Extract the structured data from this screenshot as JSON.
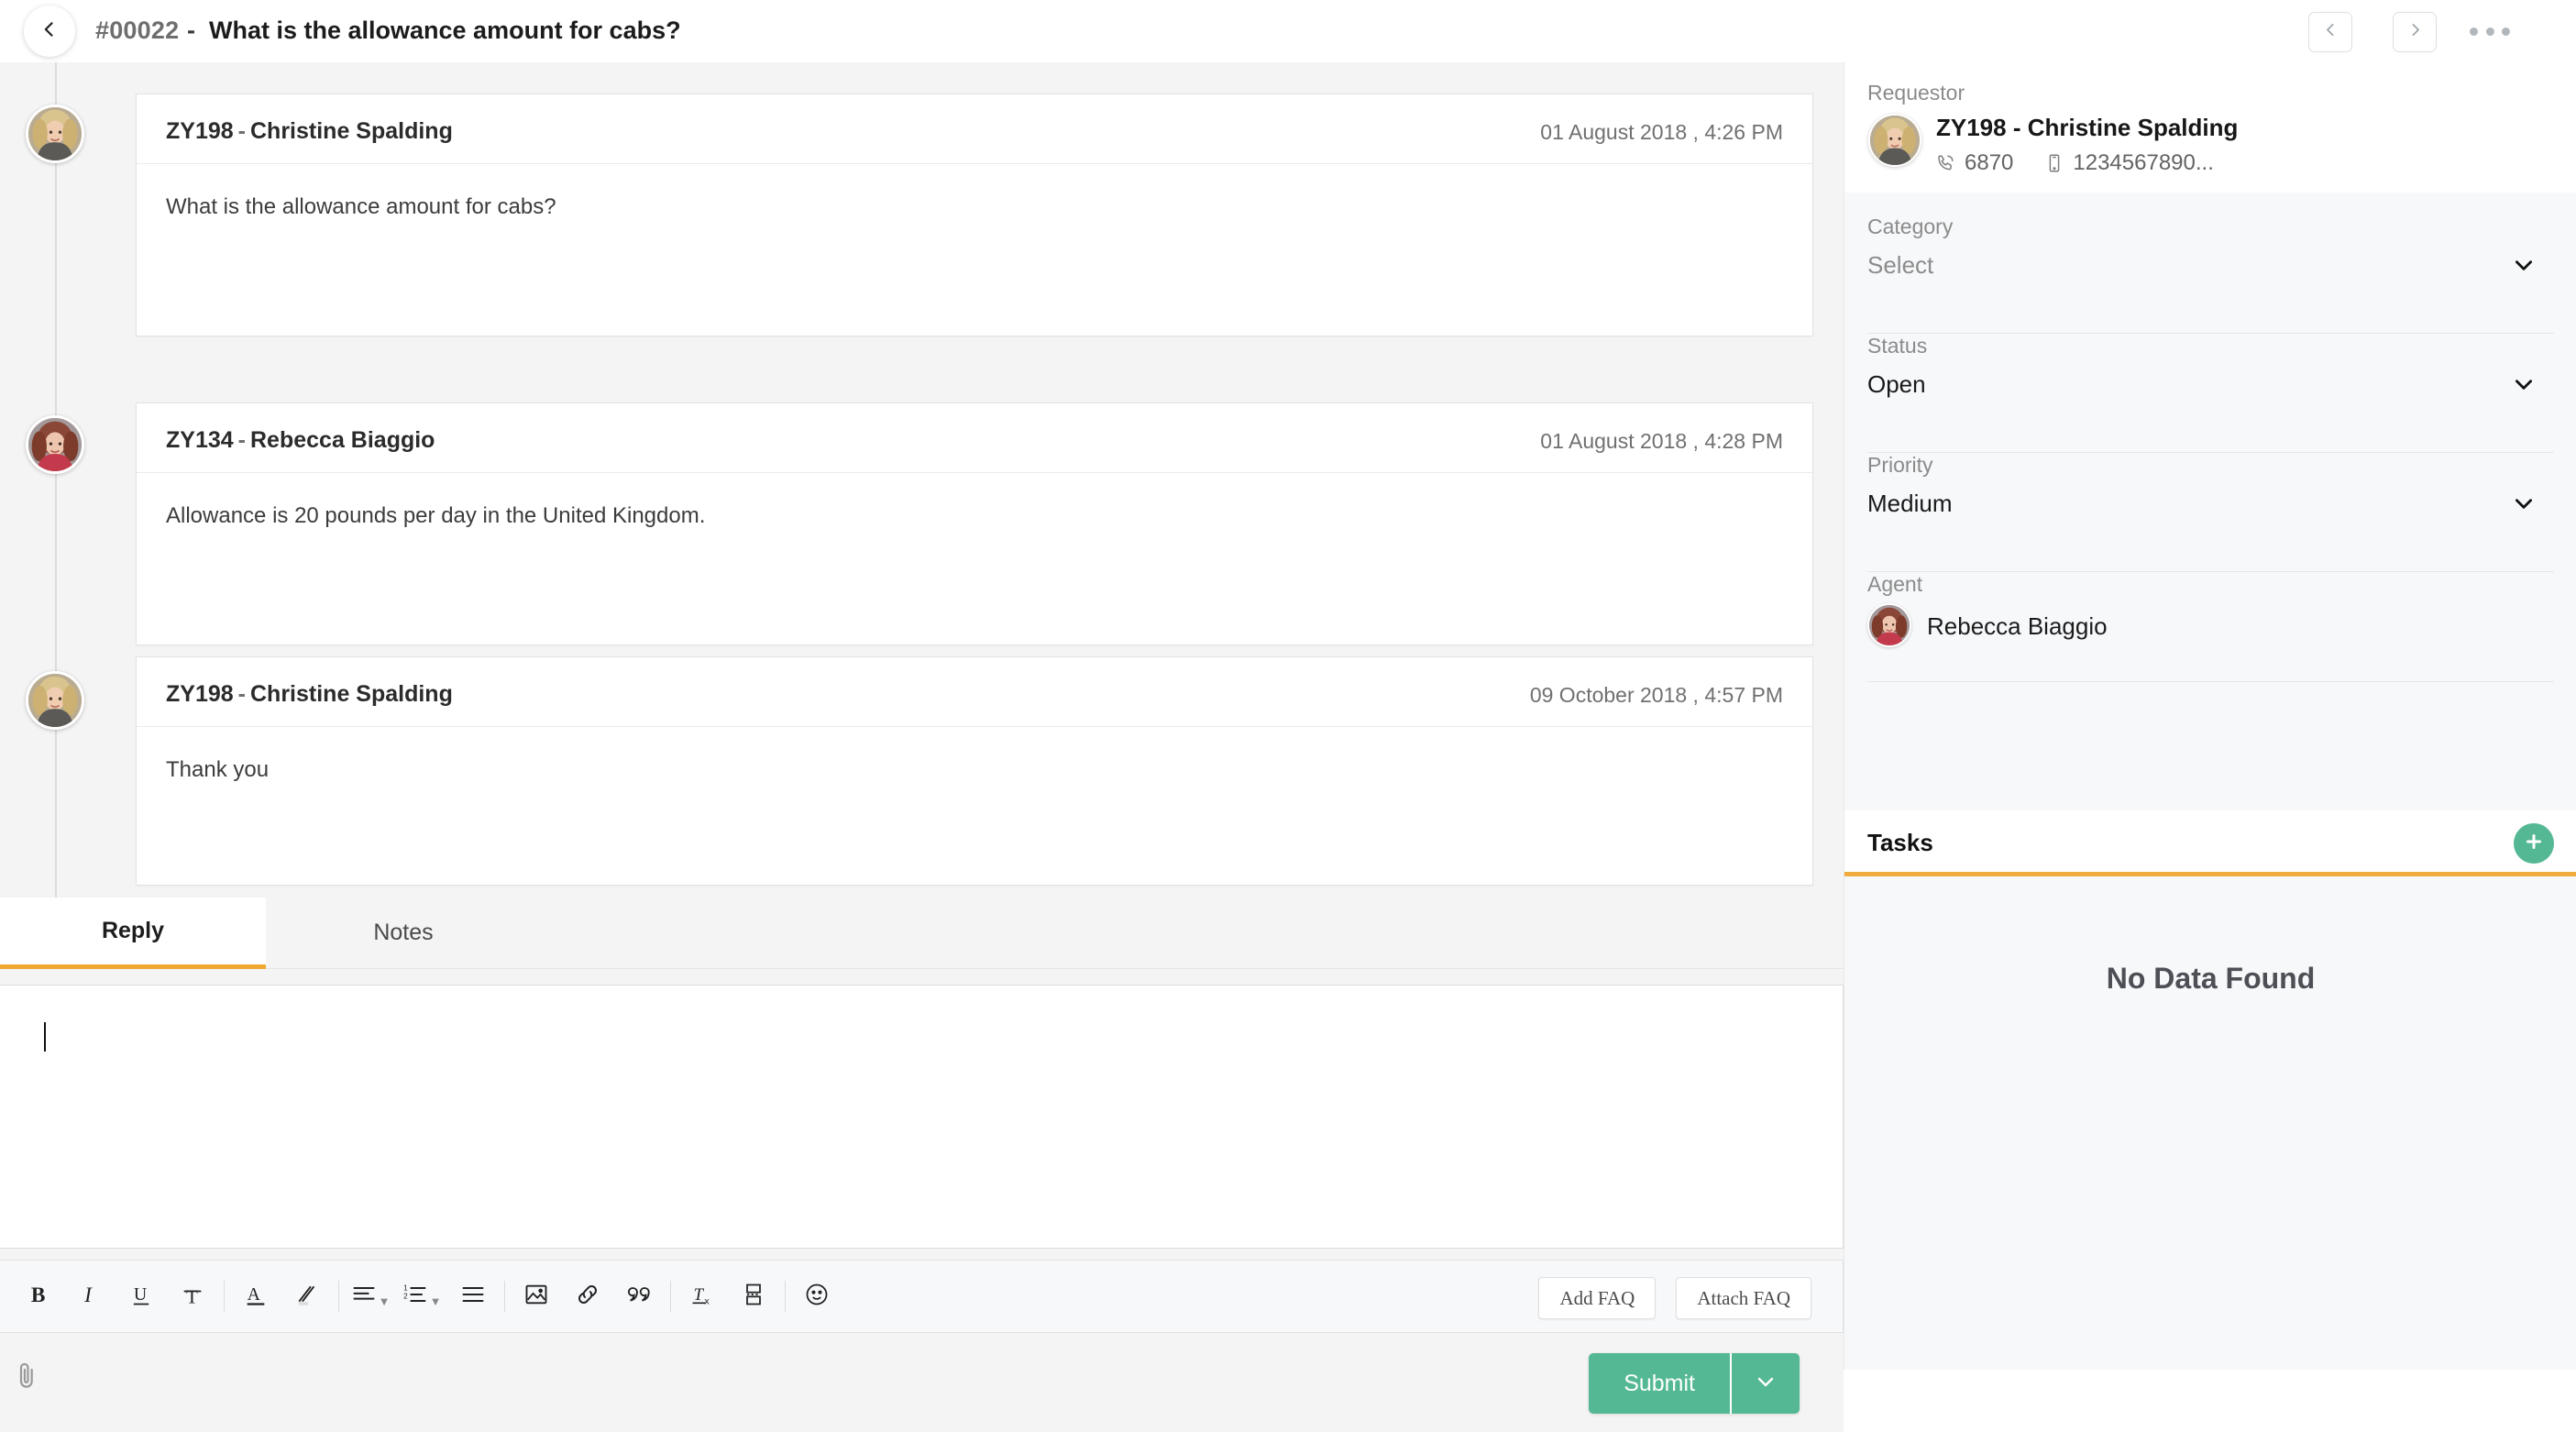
{
  "header": {
    "back_icon": "chevron-left-icon",
    "ticket_id": "#00022",
    "separator": "-",
    "subject": "What is the allowance amount for cabs?",
    "prev_icon": "chevron-left-icon",
    "next_icon": "chevron-right-icon",
    "more_icon": "ellipsis-icon"
  },
  "thread": {
    "messages": [
      {
        "code": "ZY198",
        "sep": "-",
        "name": "Christine Spalding",
        "timestamp": "01 August 2018 , 4:26 PM",
        "body": "What is the allowance amount for cabs?"
      },
      {
        "code": "ZY134",
        "sep": "-",
        "name": "Rebecca Biaggio",
        "timestamp": "01 August 2018 , 4:28 PM",
        "body": "Allowance is 20 pounds per day in the United Kingdom."
      },
      {
        "code": "ZY198",
        "sep": "-",
        "name": "Christine Spalding",
        "timestamp": "09 October 2018 , 4:57 PM",
        "body": "Thank you"
      }
    ]
  },
  "composer": {
    "tabs": [
      {
        "label": "Reply",
        "active": true
      },
      {
        "label": "Notes",
        "active": false
      }
    ],
    "editor_value": "",
    "toolbar": [
      {
        "name": "bold-icon",
        "label": "B"
      },
      {
        "name": "italic-icon",
        "label": "I"
      },
      {
        "name": "underline-icon",
        "label": "U"
      },
      {
        "name": "strikethrough-icon",
        "label": "T"
      },
      {
        "name": "font-color-icon",
        "label": "A"
      },
      {
        "name": "highlight-icon",
        "label": "pen"
      },
      {
        "name": "align-icon",
        "label": "align"
      },
      {
        "name": "ordered-list-icon",
        "label": "list"
      },
      {
        "name": "justify-icon",
        "label": "justify"
      },
      {
        "name": "insert-image-icon",
        "label": "image"
      },
      {
        "name": "insert-link-icon",
        "label": "link"
      },
      {
        "name": "blockquote-icon",
        "label": "quote"
      },
      {
        "name": "clear-format-icon",
        "label": "Tx"
      },
      {
        "name": "insert-table-icon",
        "label": "table"
      },
      {
        "name": "emoji-icon",
        "label": "smiley"
      }
    ],
    "add_faq_label": "Add FAQ",
    "attach_faq_label": "Attach FAQ",
    "attach_icon": "paperclip-icon",
    "submit_label": "Submit",
    "submit_caret_icon": "chevron-down-icon"
  },
  "sidebar": {
    "requestor": {
      "label": "Requestor",
      "name": "ZY198 - Christine Spalding",
      "phone_icon": "phone-icon",
      "phone": "6870",
      "mobile_icon": "mobile-icon",
      "mobile": "1234567890..."
    },
    "fields": [
      {
        "label": "Category",
        "value": "Select",
        "placeholder": true,
        "caret_icon": "chevron-down-icon"
      },
      {
        "label": "Status",
        "value": "Open",
        "placeholder": false,
        "caret_icon": "chevron-down-icon"
      },
      {
        "label": "Priority",
        "value": "Medium",
        "placeholder": false,
        "caret_icon": "chevron-down-icon"
      }
    ],
    "agent": {
      "label": "Agent",
      "name": "Rebecca Biaggio"
    },
    "tasks": {
      "title": "Tasks",
      "add_icon": "plus-icon",
      "empty_text": "No Data Found"
    }
  },
  "colors": {
    "accent_orange": "#f0ad3e",
    "accent_green": "#55b894",
    "page_bg": "#f4f4f4",
    "sidebar_bg": "#f7f8fa"
  }
}
